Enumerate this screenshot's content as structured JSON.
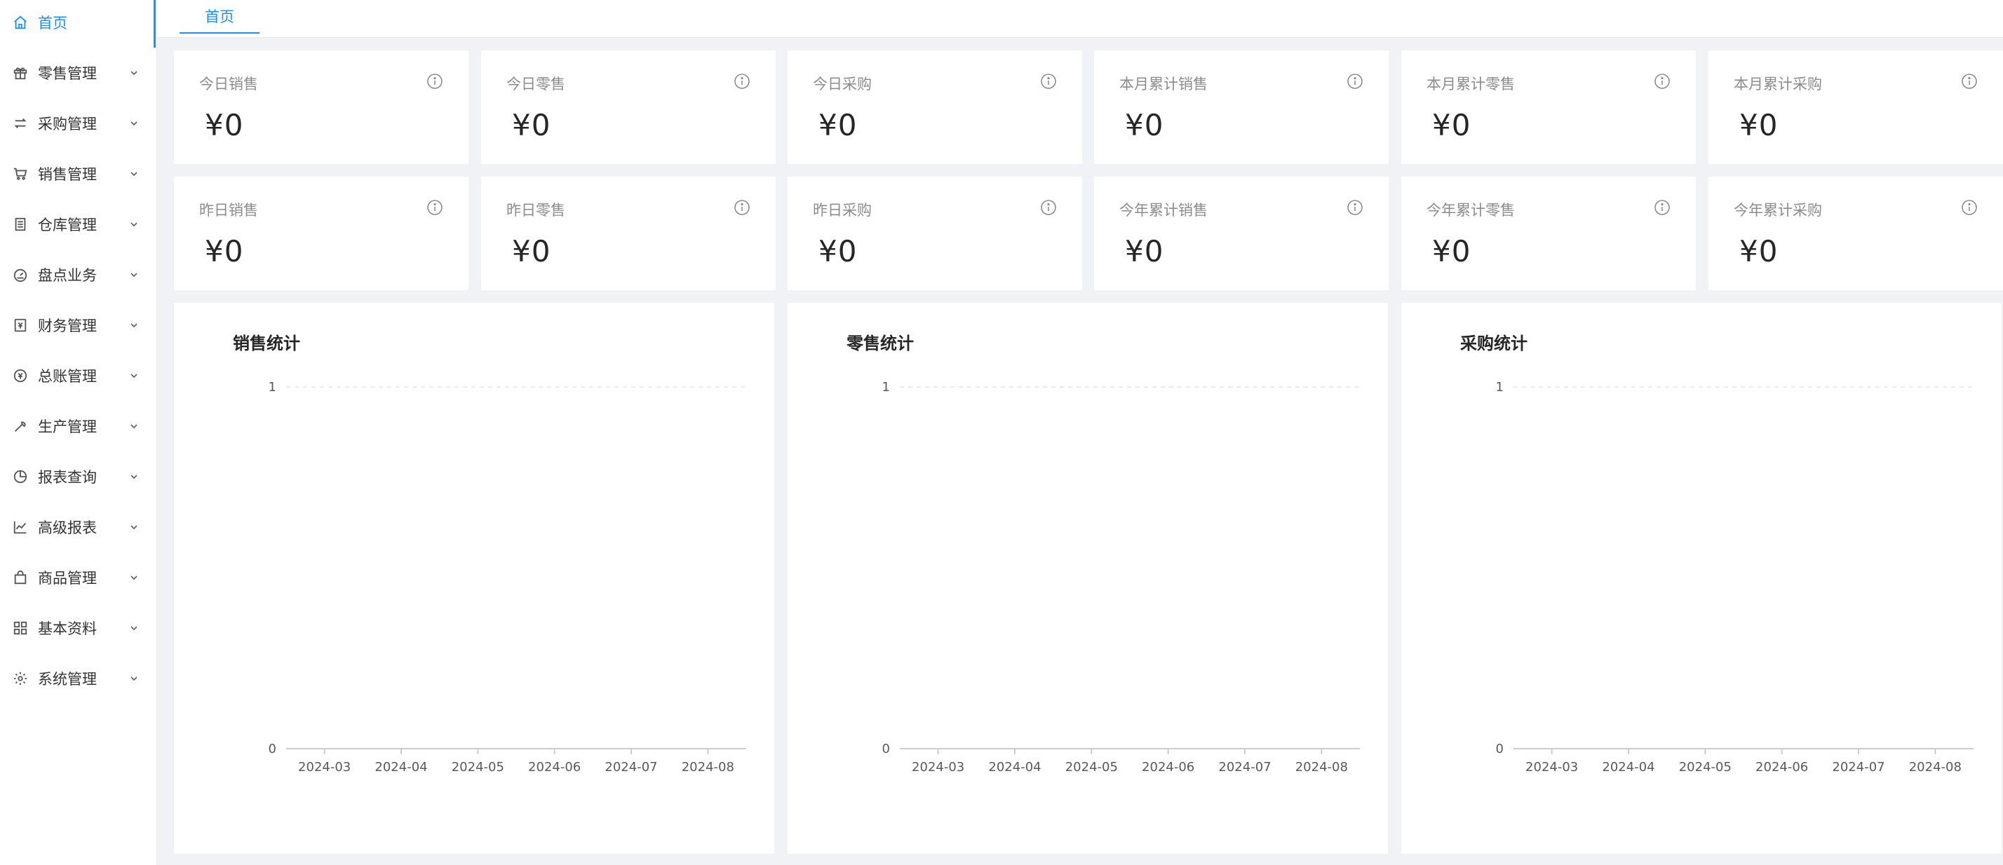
{
  "sidebar": {
    "items": [
      {
        "label": "首页",
        "icon": "home-icon",
        "active": true
      },
      {
        "label": "零售管理",
        "icon": "gift-icon"
      },
      {
        "label": "采购管理",
        "icon": "swap-icon"
      },
      {
        "label": "销售管理",
        "icon": "cart-icon"
      },
      {
        "label": "仓库管理",
        "icon": "warehouse-icon"
      },
      {
        "label": "盘点业务",
        "icon": "dashboard-icon"
      },
      {
        "label": "财务管理",
        "icon": "finance-icon"
      },
      {
        "label": "总账管理",
        "icon": "ledger-icon"
      },
      {
        "label": "生产管理",
        "icon": "tool-icon"
      },
      {
        "label": "报表查询",
        "icon": "pie-chart-icon"
      },
      {
        "label": "高级报表",
        "icon": "line-chart-icon"
      },
      {
        "label": "商品管理",
        "icon": "shopping-bag-icon"
      },
      {
        "label": "基本资料",
        "icon": "appstore-icon"
      },
      {
        "label": "系统管理",
        "icon": "setting-icon"
      }
    ]
  },
  "tabs": [
    {
      "label": "首页"
    }
  ],
  "stats": [
    {
      "title": "今日销售",
      "value": "¥0"
    },
    {
      "title": "今日零售",
      "value": "¥0"
    },
    {
      "title": "今日采购",
      "value": "¥0"
    },
    {
      "title": "本月累计销售",
      "value": "¥0"
    },
    {
      "title": "本月累计零售",
      "value": "¥0"
    },
    {
      "title": "本月累计采购",
      "value": "¥0"
    },
    {
      "title": "昨日销售",
      "value": "¥0"
    },
    {
      "title": "昨日零售",
      "value": "¥0"
    },
    {
      "title": "昨日采购",
      "value": "¥0"
    },
    {
      "title": "今年累计销售",
      "value": "¥0"
    },
    {
      "title": "今年累计零售",
      "value": "¥0"
    },
    {
      "title": "今年累计采购",
      "value": "¥0"
    }
  ],
  "colors": {
    "accent": "#1890ff",
    "axis": "#cccccc",
    "grid": "#e6e6e6"
  },
  "chart_data": [
    {
      "type": "line",
      "title": "销售统计",
      "categories": [
        "2024-03",
        "2024-04",
        "2024-05",
        "2024-06",
        "2024-07",
        "2024-08"
      ],
      "values": [
        0,
        0,
        0,
        0,
        0,
        0
      ],
      "yticks": [
        "0",
        "1"
      ],
      "ylim": [
        0,
        1
      ],
      "grid": true
    },
    {
      "type": "line",
      "title": "零售统计",
      "categories": [
        "2024-03",
        "2024-04",
        "2024-05",
        "2024-06",
        "2024-07",
        "2024-08"
      ],
      "values": [
        0,
        0,
        0,
        0,
        0,
        0
      ],
      "yticks": [
        "0",
        "1"
      ],
      "ylim": [
        0,
        1
      ],
      "grid": true
    },
    {
      "type": "line",
      "title": "采购统计",
      "categories": [
        "2024-03",
        "2024-04",
        "2024-05",
        "2024-06",
        "2024-07",
        "2024-08"
      ],
      "values": [
        0,
        0,
        0,
        0,
        0,
        0
      ],
      "yticks": [
        "0",
        "1"
      ],
      "ylim": [
        0,
        1
      ],
      "grid": true
    }
  ]
}
